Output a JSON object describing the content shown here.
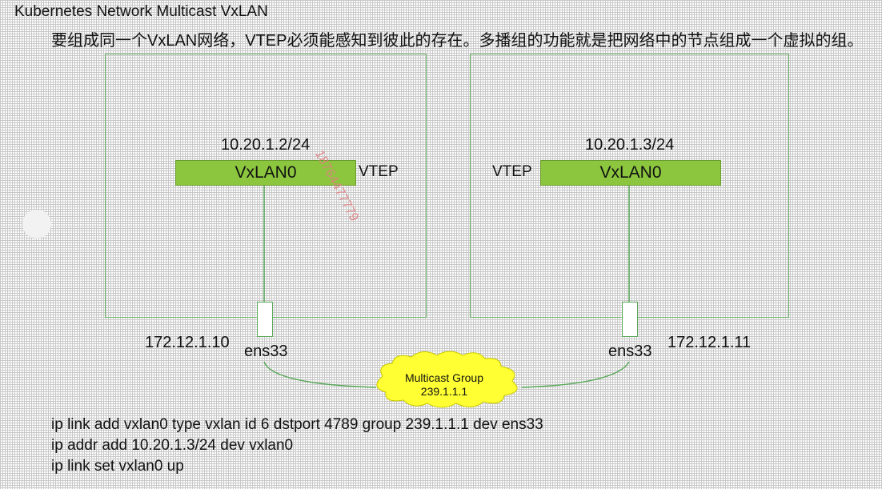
{
  "title": "Kubernetes Network Multicast VxLAN",
  "subtitle": "要组成同一个VxLAN网络，VTEP必须能感知到彼此的存在。多播组的功能就是把网络中的节点组成一个虚拟的组。",
  "watermark": "18764477779",
  "hosts": [
    {
      "overlay_ip": "10.20.1.2/24",
      "vxlan_label": "VxLAN0",
      "vtep_label": "VTEP",
      "host_ip": "172.12.1.10",
      "nic_label": "ens33"
    },
    {
      "overlay_ip": "10.20.1.3/24",
      "vxlan_label": "VxLAN0",
      "vtep_label": "VTEP",
      "host_ip": "172.12.1.11",
      "nic_label": "ens33"
    }
  ],
  "multicast": {
    "line1": "Multicast Group",
    "line2": "239.1.1.1",
    "cloud_color": "#ffff33"
  },
  "commands": [
    "ip link add vxlan0 type vxlan id 6 dstport 4789 group 239.1.1.1 dev ens33",
    "ip addr add 10.20.1.3/24 dev vxlan0",
    "ip link set vxlan0 up"
  ],
  "colors": {
    "vxlan_fill": "#8cc63e",
    "box_border": "#6db46a",
    "link_line": "#5aa85a"
  }
}
